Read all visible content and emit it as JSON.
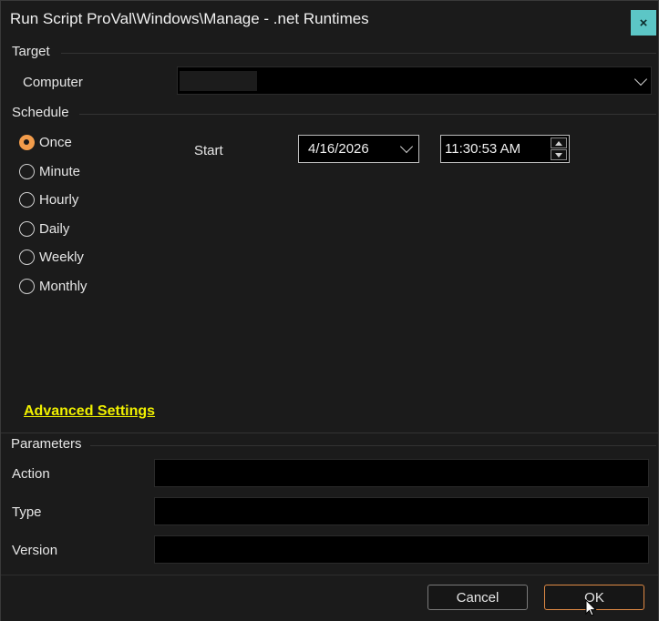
{
  "window": {
    "title": "Run Script ProVal\\Windows\\Manage - .net Runtimes",
    "close_label": "×"
  },
  "target": {
    "group_label": "Target",
    "computer_label": "Computer",
    "computer_value": ""
  },
  "schedule": {
    "group_label": "Schedule",
    "options": [
      {
        "label": "Once",
        "checked": true
      },
      {
        "label": "Minute",
        "checked": false
      },
      {
        "label": "Hourly",
        "checked": false
      },
      {
        "label": "Daily",
        "checked": false
      },
      {
        "label": "Weekly",
        "checked": false
      },
      {
        "label": "Monthly",
        "checked": false
      }
    ],
    "start_label": "Start",
    "start_date": "4/16/2026",
    "start_time": "11:30:53 AM"
  },
  "advanced_settings_label": "Advanced Settings",
  "parameters": {
    "group_label": "Parameters",
    "fields": [
      {
        "label": "Action",
        "value": ""
      },
      {
        "label": "Type",
        "value": ""
      },
      {
        "label": "Version",
        "value": ""
      }
    ]
  },
  "buttons": {
    "cancel_label": "Cancel",
    "ok_label": "OK"
  },
  "colors": {
    "background": "#1b1b1b",
    "close_button": "#5cc6c6",
    "accent_orange": "#f29c4b",
    "link_yellow": "#f0f000"
  }
}
